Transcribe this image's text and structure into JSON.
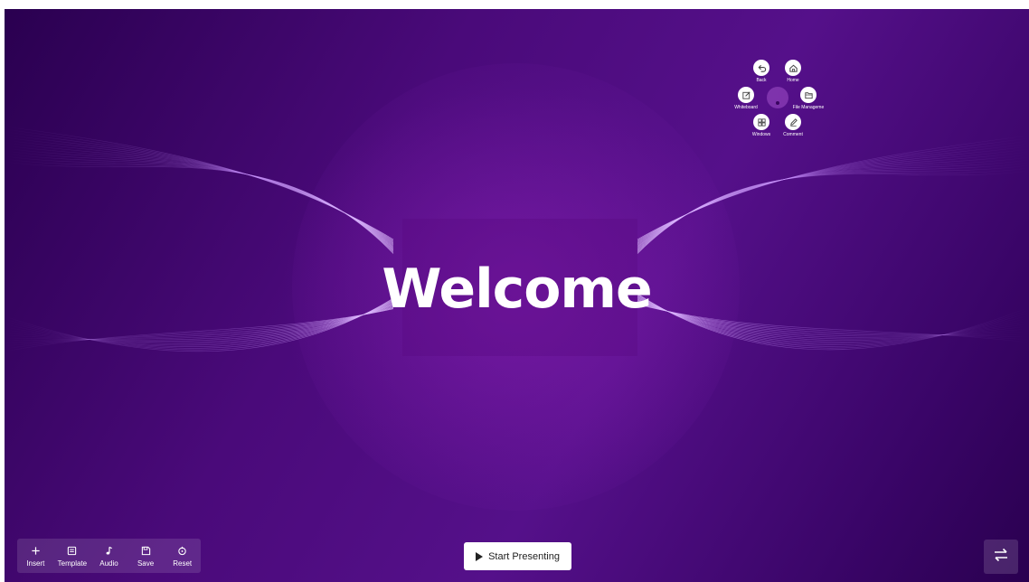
{
  "canvas": {
    "title": "Welcome",
    "colors": {
      "background": "#4a0a7a",
      "text": "#ffffff"
    }
  },
  "radial_menu": {
    "items": [
      {
        "label": "Back",
        "icon": "undo-icon"
      },
      {
        "label": "Home",
        "icon": "home-icon"
      },
      {
        "label": "Whiteboard",
        "icon": "whiteboard-icon"
      },
      {
        "label": "File Manageme",
        "icon": "folder-icon"
      },
      {
        "label": "Windows",
        "icon": "windows-grid-icon"
      },
      {
        "label": "Comment",
        "icon": "pen-icon"
      }
    ]
  },
  "toolbar": {
    "items": [
      {
        "label": "Insert",
        "icon": "plus-icon"
      },
      {
        "label": "Template",
        "icon": "template-icon"
      },
      {
        "label": "Audio",
        "icon": "music-note-icon"
      },
      {
        "label": "Save",
        "icon": "save-icon"
      },
      {
        "label": "Reset",
        "icon": "reset-icon"
      }
    ]
  },
  "start_button": {
    "label": "Start Presenting",
    "icon": "play-icon"
  },
  "switch_button": {
    "icon": "swap-arrows-icon"
  }
}
